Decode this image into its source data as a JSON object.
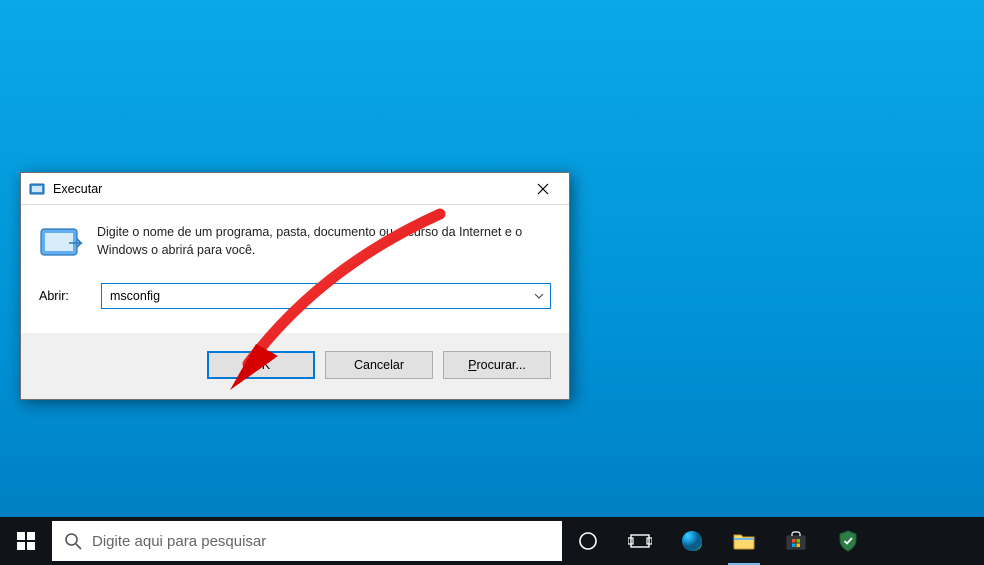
{
  "dialog": {
    "title": "Executar",
    "message": "Digite o nome de um programa, pasta, documento ou recurso da Internet e o Windows o abrirá para você.",
    "open_label": "Abrir:",
    "input_value": "msconfig",
    "buttons": {
      "ok": "OK",
      "cancel": "Cancelar",
      "browse": "Procurar..."
    }
  },
  "taskbar": {
    "search_placeholder": "Digite aqui para pesquisar"
  }
}
